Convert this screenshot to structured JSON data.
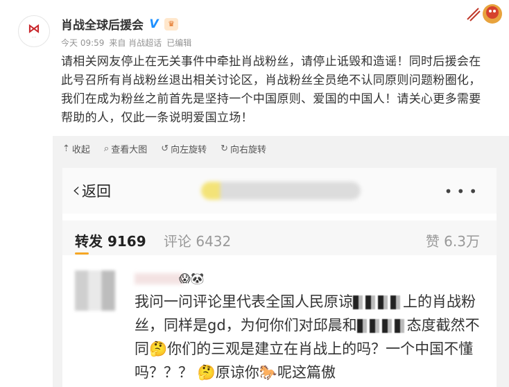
{
  "post": {
    "author": "肖战全球后援会",
    "meta": {
      "time": "今天 09:59",
      "source": "来自 肖战超话",
      "edited": "已编辑"
    },
    "text": "请相关网友停止在无关事件中牵扯肖战粉丝，请停止诋毁和造谣！同时后援会在此号召所有肖战粉丝退出相关讨论区，肖战粉丝全员绝不认同原则问题粉圈化，我们在成为粉丝之前首先是坚持一个中国原则、爱国的中国人！请关心更多需要帮助的人，仅此一条说明爱国立场！"
  },
  "image_toolbar": {
    "collapse": "收起",
    "view_large": "查看大图",
    "rotate_left": "向左旋转",
    "rotate_right": "向右旋转"
  },
  "screenshot": {
    "back_label": "返回",
    "tabs": {
      "repost": "转发 9169",
      "comments": "评论 6432",
      "likes": "赞 6.3万"
    },
    "comment_text": {
      "p1": "我问一问评论里代表全国人民原谅",
      "p2": "上的肖战粉丝，同样是gd，为何你们对邱晨和",
      "p3": "态度截然不同",
      "p4": "你们的三观是建立在肖战",
      "p5": "上的吗？一个中国不懂吗？？？",
      "p6": "原谅你",
      "p7": "呢这篇傲"
    }
  },
  "colors": {
    "accent_underline": "#f6a623",
    "verified_blue": "#1e90ff",
    "logo_red": "#c8262b"
  },
  "icons": [
    "verified-icon",
    "fan-badge-icon",
    "collapse-icon",
    "zoom-icon",
    "rotate-left-icon",
    "rotate-right-icon",
    "back-chevron-icon",
    "more-icon"
  ]
}
